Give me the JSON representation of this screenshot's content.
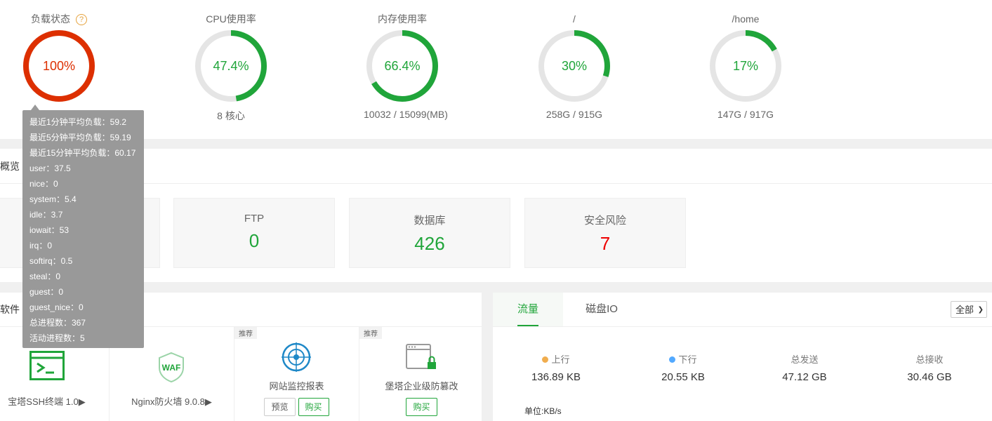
{
  "gauges": [
    {
      "title": "负载状态",
      "value": "100%",
      "percent": 100,
      "subtitle": "",
      "color": "#dd2f00",
      "help_icon": "question-circle-icon"
    },
    {
      "title": "CPU使用率",
      "value": "47.4%",
      "percent": 47.4,
      "subtitle": "8 核心",
      "color": "#20a53a"
    },
    {
      "title": "内存使用率",
      "value": "66.4%",
      "percent": 66.4,
      "subtitle": "10032 / 15099(MB)",
      "color": "#20a53a"
    },
    {
      "title": "/",
      "value": "30%",
      "percent": 30,
      "subtitle": "258G / 915G",
      "color": "#20a53a"
    },
    {
      "title": "/home",
      "value": "17%",
      "percent": 17,
      "subtitle": "147G / 917G",
      "color": "#20a53a"
    }
  ],
  "tooltip": {
    "lines": [
      "最近1分钟平均负载：59.2",
      "最近5分钟平均负载：59.19",
      "最近15分钟平均负载：60.17",
      "user：37.5",
      "nice：0",
      "system：5.4",
      "idle：3.7",
      "iowait：53",
      "irq：0",
      "softirq：0.5",
      "steal：0",
      "guest：0",
      "guest_nice：0",
      "总进程数：367",
      "活动进程数：5"
    ]
  },
  "overview": {
    "title": "概览",
    "cards": [
      {
        "label": "FTP",
        "value": "0"
      },
      {
        "label": "数据库",
        "value": "426"
      },
      {
        "label": "安全风险",
        "value": "7"
      }
    ]
  },
  "software": {
    "title": "软件",
    "apps": [
      {
        "name": "宝塔SSH终端 1.0▶",
        "icon": "terminal-icon"
      },
      {
        "name": "Nginx防火墙 9.0.8▶",
        "icon": "waf-shield-icon",
        "icon_text": "WAF"
      },
      {
        "tag": "推荐",
        "name": "网站监控报表",
        "icon": "radar-target-icon",
        "btn_preview": "预览",
        "btn_buy": "购买"
      },
      {
        "tag": "推荐",
        "name": "堡塔企业级防篡改",
        "icon": "window-lock-icon",
        "btn_buy": "购买"
      }
    ]
  },
  "traffic": {
    "tabs": [
      "流量",
      "磁盘IO"
    ],
    "select_value": "全部",
    "stats": [
      {
        "label": "上行",
        "value": "136.89 KB",
        "dot": "#f0ad4e"
      },
      {
        "label": "下行",
        "value": "20.55 KB",
        "dot": "#52a9ff"
      },
      {
        "label": "总发送",
        "value": "47.12 GB"
      },
      {
        "label": "总接收",
        "value": "30.46 GB"
      }
    ],
    "unit": "单位:KB/s"
  }
}
